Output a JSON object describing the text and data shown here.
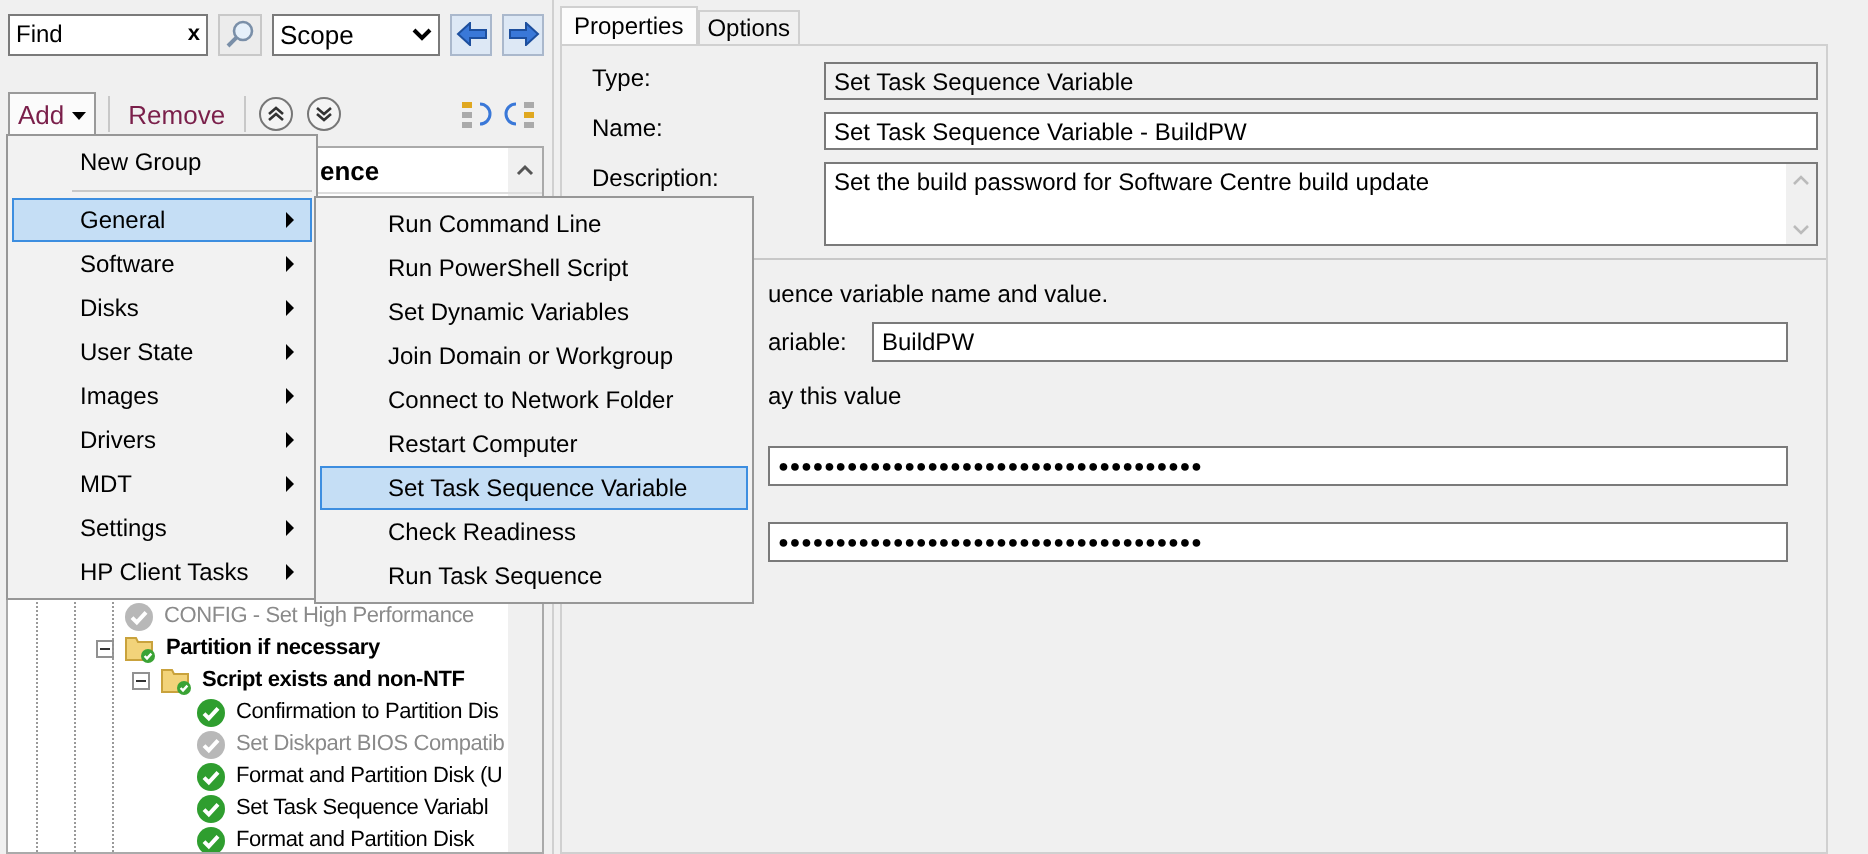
{
  "search": {
    "placeholder": "Find",
    "clear": "x"
  },
  "scope": {
    "value": "Scope"
  },
  "toolbar": {
    "add": "Add",
    "remove": "Remove"
  },
  "tree": {
    "header": "ence",
    "items": [
      {
        "label": "CONFIG - Set High Performance",
        "kind": "step",
        "disabled": true
      },
      {
        "label": "Partition if necessary",
        "kind": "group",
        "expanded": true,
        "children": [
          {
            "label": "Script exists and non-NTF",
            "kind": "group",
            "expanded": true,
            "children": [
              {
                "label": "Confirmation to Partition Dis",
                "kind": "step",
                "disabled": false
              },
              {
                "label": "Set Diskpart BIOS Compatib",
                "kind": "step",
                "disabled": true
              },
              {
                "label": "Format and Partition Disk (U",
                "kind": "step",
                "disabled": false
              },
              {
                "label": "Set Task Sequence Variabl",
                "kind": "step",
                "disabled": false
              },
              {
                "label": "Format and Partition Disk",
                "kind": "step",
                "disabled": false
              }
            ]
          }
        ]
      }
    ]
  },
  "add_menu": {
    "items": [
      {
        "kind": "item",
        "label": "New Group",
        "has_submenu": false,
        "selected": false
      },
      {
        "kind": "separator"
      },
      {
        "kind": "item",
        "label": "General",
        "has_submenu": true,
        "selected": true
      },
      {
        "kind": "item",
        "label": "Software",
        "has_submenu": true,
        "selected": false
      },
      {
        "kind": "item",
        "label": "Disks",
        "has_submenu": true,
        "selected": false
      },
      {
        "kind": "item",
        "label": "User State",
        "has_submenu": true,
        "selected": false
      },
      {
        "kind": "item",
        "label": "Images",
        "has_submenu": true,
        "selected": false
      },
      {
        "kind": "item",
        "label": "Drivers",
        "has_submenu": true,
        "selected": false
      },
      {
        "kind": "item",
        "label": "MDT",
        "has_submenu": true,
        "selected": false
      },
      {
        "kind": "item",
        "label": "Settings",
        "has_submenu": true,
        "selected": false
      },
      {
        "kind": "item",
        "label": "HP Client Tasks",
        "has_submenu": true,
        "selected": false
      }
    ]
  },
  "submenu": {
    "items": [
      {
        "label": "Run Command Line",
        "selected": false
      },
      {
        "label": "Run PowerShell Script",
        "selected": false
      },
      {
        "label": "Set Dynamic Variables",
        "selected": false
      },
      {
        "label": "Join Domain or Workgroup",
        "selected": false
      },
      {
        "label": "Connect to Network Folder",
        "selected": false
      },
      {
        "label": "Restart Computer",
        "selected": false
      },
      {
        "label": "Set Task Sequence Variable",
        "selected": true
      },
      {
        "label": "Check Readiness",
        "selected": false
      },
      {
        "label": "Run Task Sequence",
        "selected": false
      }
    ]
  },
  "tabs": [
    {
      "label": "Properties",
      "selected": true
    },
    {
      "label": "Options",
      "selected": false
    }
  ],
  "properties": {
    "fields": [
      {
        "label": "Type:",
        "value": "Set Task Sequence Variable",
        "kind": "readonly"
      },
      {
        "label": "Name:",
        "value": "Set Task Sequence Variable - BuildPW",
        "kind": "text"
      },
      {
        "label": "Description:",
        "value": "Set the build password for Software Centre build update",
        "kind": "multiline"
      }
    ]
  },
  "variable": {
    "intro": "uence variable name and value.",
    "label": "ariable:",
    "value": "BuildPW",
    "hide_label": "ay this value",
    "password": "●●●●●●●●●●●●●●●●●●●●●●●●●●●●●●●●●●●●●",
    "confirm": "●●●●●●●●●●●●●●●●●●●●●●●●●●●●●●●●●●●●●"
  }
}
